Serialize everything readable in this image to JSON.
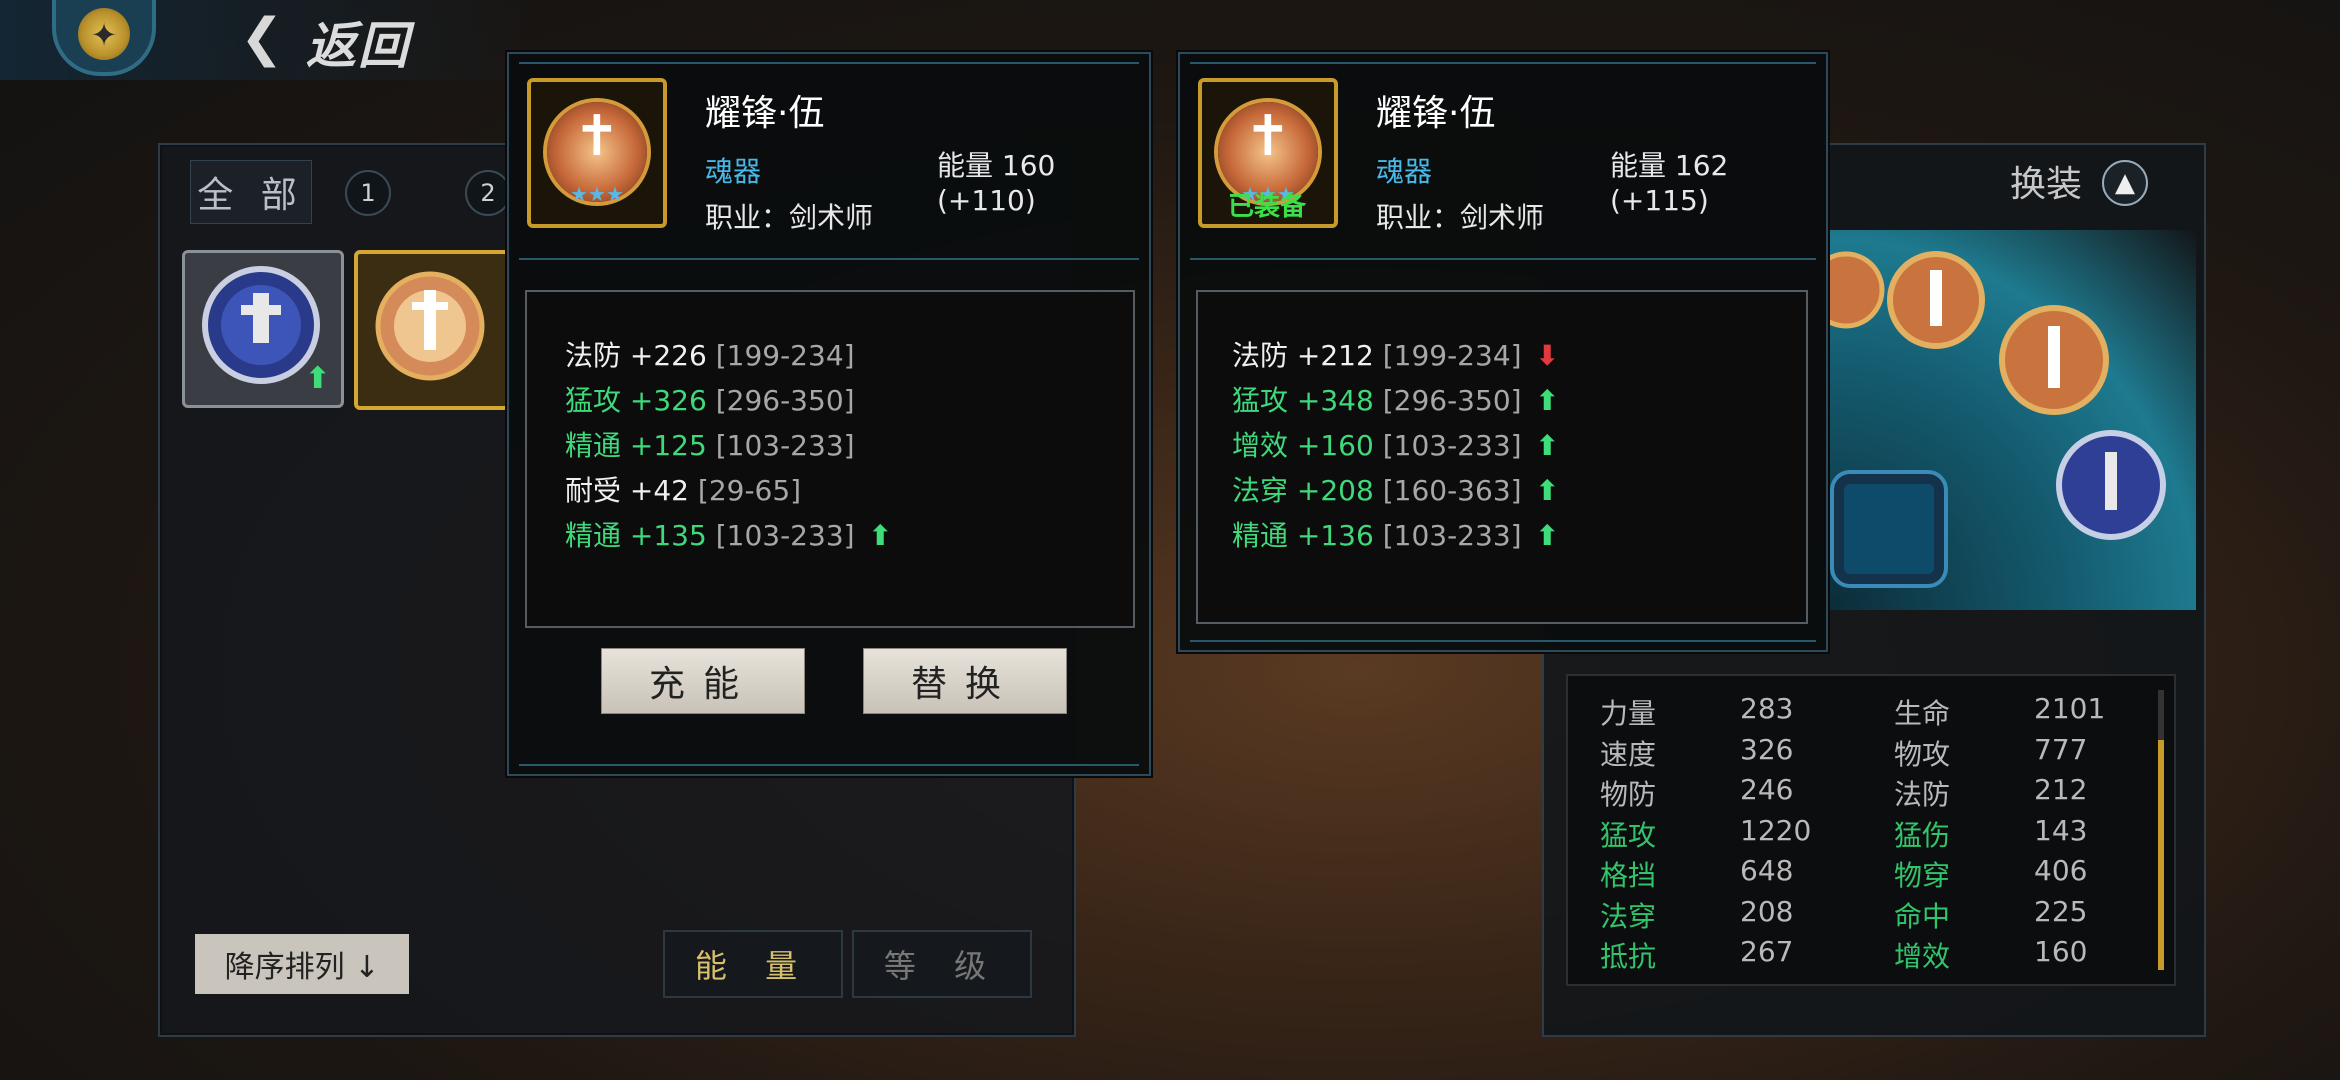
{
  "header": {
    "back_label": "返回"
  },
  "inventory": {
    "tab_all": "全 部",
    "tab_1": "1",
    "tab_2": "2",
    "sort_label": "降序排列 ↓",
    "sort_energy": "能 量",
    "sort_level": "等 级"
  },
  "equip_panel": {
    "swap_label": "换装"
  },
  "popup_left": {
    "name": "耀锋·伍",
    "type": "魂器",
    "energy": "能量 160 (+110)",
    "job": "职业：剑术师",
    "stats": [
      {
        "name": "法防",
        "value": "+226",
        "range": "[199-234]",
        "color": "white",
        "arrow": ""
      },
      {
        "name": "猛攻",
        "value": "+326",
        "range": "[296-350]",
        "color": "green",
        "arrow": ""
      },
      {
        "name": "精通",
        "value": "+125",
        "range": "[103-233]",
        "color": "green",
        "arrow": ""
      },
      {
        "name": "耐受",
        "value": "+42",
        "range": "[29-65]",
        "color": "white",
        "arrow": ""
      },
      {
        "name": "精通",
        "value": "+135",
        "range": "[103-233]",
        "color": "green",
        "arrow": "up"
      }
    ],
    "charge_button": "充能",
    "replace_button": "替换"
  },
  "popup_right": {
    "name": "耀锋·伍",
    "type": "魂器",
    "energy": "能量 162 (+115)",
    "job": "职业：剑术师",
    "equipped_tag": "已装备",
    "stats": [
      {
        "name": "法防",
        "value": "+212",
        "range": "[199-234]",
        "color": "white",
        "arrow": "down"
      },
      {
        "name": "猛攻",
        "value": "+348",
        "range": "[296-350]",
        "color": "green",
        "arrow": "up"
      },
      {
        "name": "增效",
        "value": "+160",
        "range": "[103-233]",
        "color": "green",
        "arrow": "up"
      },
      {
        "name": "法穿",
        "value": "+208",
        "range": "[160-363]",
        "color": "green",
        "arrow": "up"
      },
      {
        "name": "精通",
        "value": "+136",
        "range": "[103-233]",
        "color": "green",
        "arrow": "up"
      }
    ]
  },
  "character_stats": [
    {
      "label": "力量",
      "value": "283",
      "color": "white"
    },
    {
      "label": "生命",
      "value": "2101",
      "color": "white"
    },
    {
      "label": "速度",
      "value": "326",
      "color": "white"
    },
    {
      "label": "物攻",
      "value": "777",
      "color": "white"
    },
    {
      "label": "物防",
      "value": "246",
      "color": "white"
    },
    {
      "label": "法防",
      "value": "212",
      "color": "white"
    },
    {
      "label": "猛攻",
      "value": "1220",
      "color": "green"
    },
    {
      "label": "猛伤",
      "value": "143",
      "color": "green"
    },
    {
      "label": "格挡",
      "value": "648",
      "color": "green"
    },
    {
      "label": "物穿",
      "value": "406",
      "color": "green"
    },
    {
      "label": "法穿",
      "value": "208",
      "color": "green"
    },
    {
      "label": "命中",
      "value": "225",
      "color": "green"
    },
    {
      "label": "抵抗",
      "value": "267",
      "color": "green"
    },
    {
      "label": "增效",
      "value": "160",
      "color": "green"
    }
  ],
  "icons": {
    "back_emblem": "compass-star-icon",
    "back_chevron": "chevron-left-icon",
    "swap": "rotate-icon",
    "item": "sword-emblem-icon",
    "up": "arrow-up-icon",
    "down": "arrow-down-icon"
  },
  "colors": {
    "stat_green": "#3fd87a",
    "stat_white": "#f0f0f0",
    "type_blue": "#48b8e8",
    "gold_border": "#c89a2a",
    "down_red": "#e0393e"
  }
}
